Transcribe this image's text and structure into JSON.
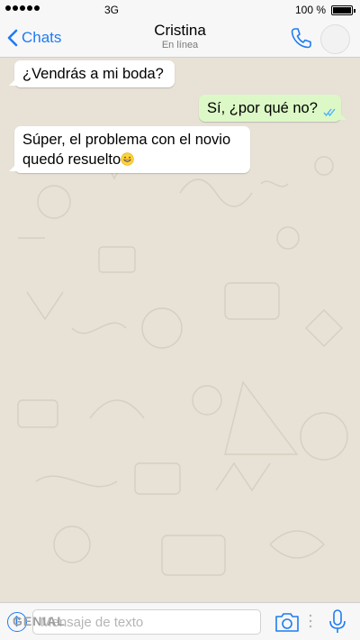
{
  "status_bar": {
    "network": "3G",
    "battery": "100 %",
    "battery_level": 1.0
  },
  "header": {
    "back_label": "Chats",
    "contact_name": "Cristina",
    "contact_status": "En línea"
  },
  "messages": [
    {
      "direction": "incoming",
      "text": "¿Vendrás a mi boda?"
    },
    {
      "direction": "outgoing",
      "text": "Sí, ¿por qué no?",
      "read": true
    },
    {
      "direction": "incoming",
      "text_line1": "Súper, el problema con el novio",
      "text_line2": "quedó resuelto",
      "emoji": "grinning-face"
    }
  ],
  "composer": {
    "placeholder": "Mensaje de texto",
    "watermark": "GENIAL"
  },
  "icons": {
    "back": "chevron-left-icon",
    "call": "phone-icon",
    "attach": "arrow-up-icon",
    "camera": "camera-icon",
    "mic": "microphone-icon"
  },
  "colors": {
    "accent": "#1e7cf2",
    "outgoing_bubble": "#dcf8c6",
    "incoming_bubble": "#ffffff",
    "wallpaper": "#e7e1d6",
    "read_ticks": "#4fb3f6"
  }
}
